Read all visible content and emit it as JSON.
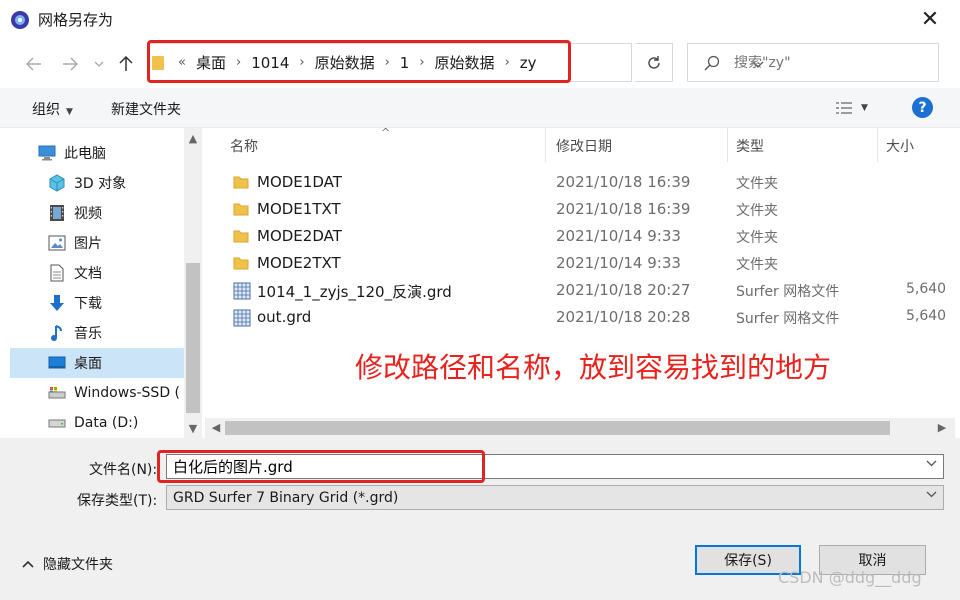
{
  "window": {
    "title": "网格另存为",
    "close_glyph": "✕"
  },
  "address": {
    "overflow": "«",
    "crumbs": [
      "桌面",
      "1014",
      "原始数据",
      "1",
      "原始数据",
      "zy"
    ],
    "separator": "›"
  },
  "search": {
    "placeholder": "搜索\"zy\""
  },
  "toolbar": {
    "organize": "组织",
    "new_folder": "新建文件夹",
    "help": "?"
  },
  "navpane": {
    "items": [
      {
        "label": "此电脑",
        "icon": "computer-icon"
      },
      {
        "label": "3D 对象",
        "icon": "3d-objects-icon"
      },
      {
        "label": "视频",
        "icon": "video-icon"
      },
      {
        "label": "图片",
        "icon": "pictures-icon"
      },
      {
        "label": "文档",
        "icon": "documents-icon"
      },
      {
        "label": "下载",
        "icon": "download-icon"
      },
      {
        "label": "音乐",
        "icon": "music-icon"
      },
      {
        "label": "桌面",
        "icon": "desktop-icon",
        "selected": true
      },
      {
        "label": "Windows-SSD (",
        "icon": "drive-icon"
      },
      {
        "label": "Data (D:)",
        "icon": "drive-icon"
      }
    ]
  },
  "filelist": {
    "columns": {
      "name": "名称",
      "date": "修改日期",
      "type": "类型",
      "size": "大小"
    },
    "rows": [
      {
        "name": "MODE1DAT",
        "date": "2021/10/18 16:39",
        "type": "文件夹",
        "size": "",
        "kind": "folder"
      },
      {
        "name": "MODE1TXT",
        "date": "2021/10/18 16:39",
        "type": "文件夹",
        "size": "",
        "kind": "folder"
      },
      {
        "name": "MODE2DAT",
        "date": "2021/10/14 9:33",
        "type": "文件夹",
        "size": "",
        "kind": "folder"
      },
      {
        "name": "MODE2TXT",
        "date": "2021/10/14 9:33",
        "type": "文件夹",
        "size": "",
        "kind": "folder"
      },
      {
        "name": "1014_1_zyjs_120_反演.grd",
        "date": "2021/10/18 20:27",
        "type": "Surfer 网格文件",
        "size": "5,640",
        "kind": "grd"
      },
      {
        "name": "out.grd",
        "date": "2021/10/18 20:28",
        "type": "Surfer 网格文件",
        "size": "5,640",
        "kind": "grd"
      }
    ]
  },
  "annotation": {
    "text": "修改路径和名称，放到容易找到的地方",
    "color": "#e8221c"
  },
  "form": {
    "filename_label": "文件名(N):",
    "filename_value": "白化后的图片.grd",
    "filetype_label": "保存类型(T):",
    "filetype_value": "GRD Surfer 7 Binary Grid (*.grd)",
    "hide_folders": "隐藏文件夹",
    "save": "保存(S)",
    "cancel": "取消"
  },
  "watermark": "CSDN @ddg__ddg",
  "colors": {
    "accent": "#0078d7",
    "highlight": "#e02424",
    "selected": "#cce4f7",
    "folder": "#f0c24b"
  }
}
